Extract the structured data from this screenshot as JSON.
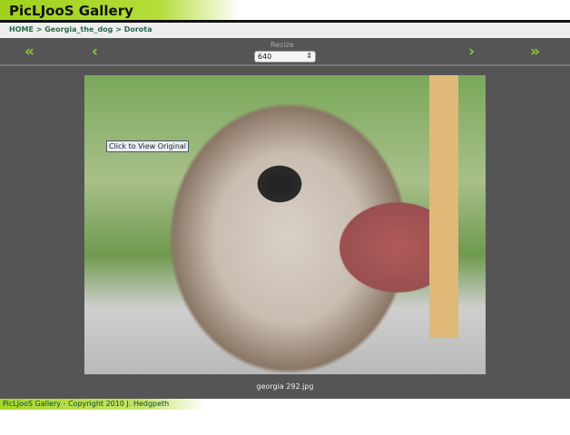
{
  "header": {
    "title": "PicLJooS Gallery"
  },
  "breadcrumb": {
    "home": "HOME",
    "sep1": " > ",
    "album": "Georgia_the_dog",
    "sep2": " > ",
    "current": "Dorota"
  },
  "nav": {
    "first": "«",
    "prev": "‹",
    "next": "›",
    "last": "»",
    "resize_label": "Resize",
    "resize_value": "640",
    "select_icon": "⇕"
  },
  "photo": {
    "tooltip": "Click to View Original",
    "caption": "georgia 292.jpg"
  },
  "footer": {
    "text": "PicLJooS Gallery - Copyright 2010 J. Hedgpeth"
  },
  "colors": {
    "accent": "#9fd21a",
    "panel": "#555555"
  }
}
